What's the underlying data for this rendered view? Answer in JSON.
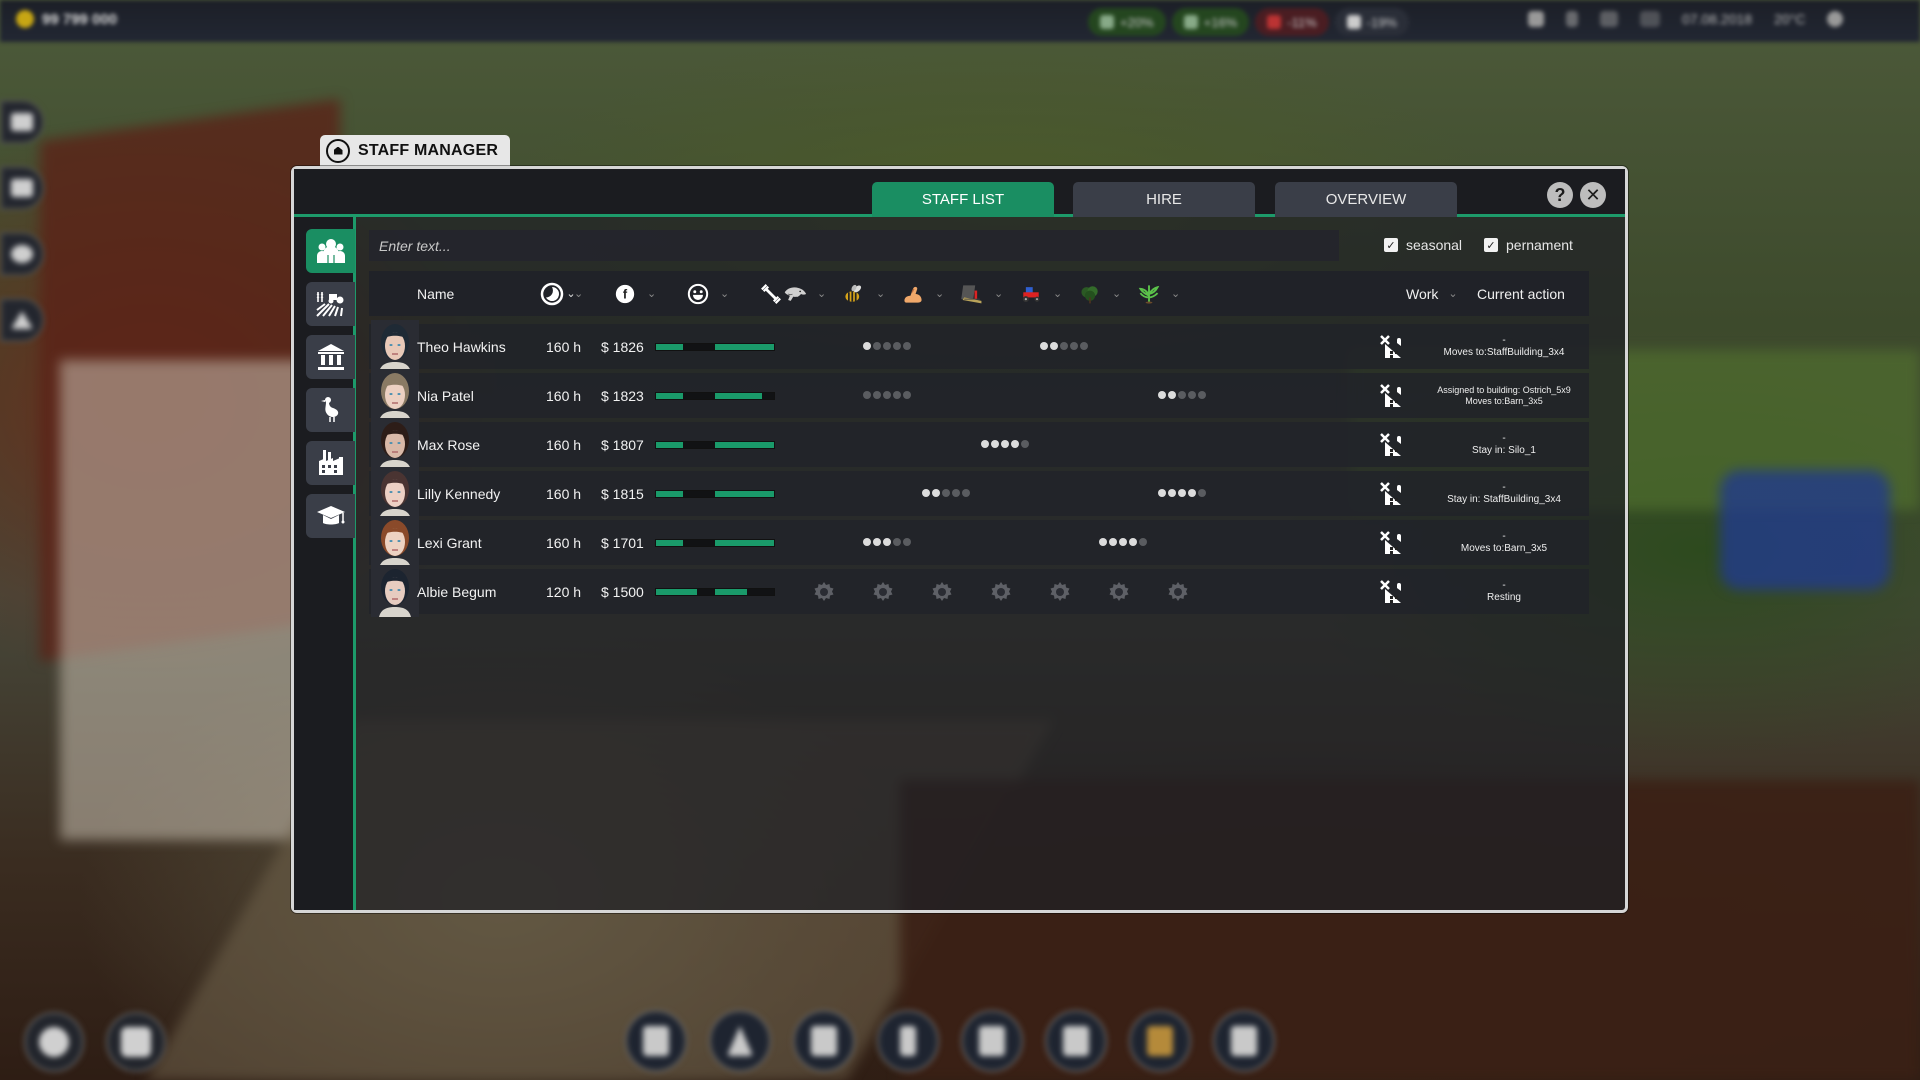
{
  "hud": {
    "money": "99 799 000",
    "stats": [
      {
        "kind": "pos",
        "icon": "trend-up-icon",
        "value": "+20%"
      },
      {
        "kind": "pos",
        "icon": "wheat-icon",
        "value": "+16%"
      },
      {
        "kind": "neg",
        "icon": "trend-down-icon",
        "value": "-11%"
      },
      {
        "kind": "neu",
        "icon": "egg-icon",
        "value": "-19%"
      }
    ],
    "date": "07.08.2018",
    "temperature": "20°C"
  },
  "window": {
    "title": "STAFF MANAGER",
    "tabs": [
      {
        "label": "STAFF LIST",
        "active": true
      },
      {
        "label": "HIRE",
        "active": false
      },
      {
        "label": "OVERVIEW",
        "active": false
      }
    ],
    "help_label": "?",
    "close_label": "✕"
  },
  "sidebar": {
    "items": [
      {
        "name": "staff",
        "icon": "people-icon",
        "active": true
      },
      {
        "name": "fields",
        "icon": "fields-tractor-icon",
        "active": false
      },
      {
        "name": "buildings",
        "icon": "bank-building-icon",
        "active": false
      },
      {
        "name": "animals",
        "icon": "goose-icon",
        "active": false
      },
      {
        "name": "factory",
        "icon": "factory-icon",
        "active": false
      },
      {
        "name": "education",
        "icon": "graduation-cap-icon",
        "active": false
      }
    ]
  },
  "filters": {
    "search_placeholder": "Enter text...",
    "search_value": "",
    "seasonal_label": "seasonal",
    "seasonal_checked": true,
    "permanent_label": "pernament",
    "permanent_checked": true
  },
  "columns": {
    "name": "Name",
    "hours_icon": "clock-icon",
    "salary_icon": "coin-icon",
    "mood_icon": "smiley-icon",
    "strength_icon": "dumbbell-icon",
    "skills": [
      {
        "icon": "cow-icon",
        "skill": "livestock"
      },
      {
        "icon": "bee-icon",
        "skill": "beekeeping"
      },
      {
        "icon": "arm-muscle-icon",
        "skill": "physical"
      },
      {
        "icon": "machine-icon",
        "skill": "processing"
      },
      {
        "icon": "tractor-icon",
        "skill": "driving"
      },
      {
        "icon": "tree-icon",
        "skill": "forestry"
      },
      {
        "icon": "plant-icon",
        "skill": "farming"
      }
    ],
    "work": "Work",
    "current_action": "Current action"
  },
  "staff": [
    {
      "name": "Theo Hawkins",
      "hours": "160 h",
      "salary": "$ 1826",
      "mood": 0.45,
      "strength": 1.0,
      "skills": [
        null,
        1,
        null,
        null,
        2,
        null,
        null
      ],
      "skill_max": 5,
      "action_line1": "-",
      "action_line2": "Moves to:StaffBuilding_3x4",
      "action_small": false,
      "hair": "#1f2a35",
      "skin": "#e8c9b8"
    },
    {
      "name": "Nia Patel",
      "hours": "160 h",
      "salary": "$ 1823",
      "mood": 0.45,
      "strength": 0.8,
      "skills": [
        null,
        0,
        null,
        null,
        null,
        null,
        2
      ],
      "skill_max": 5,
      "action_line1": "Assigned to building: Ostrich_5x9",
      "action_line2": "Moves to:Barn_3x5",
      "action_small": true,
      "hair": "#8a7a64",
      "skin": "#ecd0c2"
    },
    {
      "name": "Max Rose",
      "hours": "160 h",
      "salary": "$ 1807",
      "mood": 0.45,
      "strength": 1.0,
      "skills": [
        null,
        null,
        null,
        4,
        null,
        null,
        null
      ],
      "skill_max": 5,
      "action_line1": "-",
      "action_line2": "Stay in: Silo_1",
      "action_small": false,
      "hair": "#2d1d18",
      "skin": "#d9b9a8"
    },
    {
      "name": "Lilly Kennedy",
      "hours": "160 h",
      "salary": "$ 1815",
      "mood": 0.45,
      "strength": 1.0,
      "skills": [
        null,
        null,
        2,
        null,
        null,
        null,
        4
      ],
      "skill_max": 5,
      "action_line1": "-",
      "action_line2": "Stay in: StaffBuilding_3x4",
      "action_small": false,
      "hair": "#4a3432",
      "skin": "#ecd0c4"
    },
    {
      "name": "Lexi Grant",
      "hours": "160 h",
      "salary": "$ 1701",
      "mood": 0.45,
      "strength": 1.0,
      "skills": [
        null,
        3,
        null,
        null,
        null,
        4,
        null
      ],
      "skill_max": 5,
      "action_line1": "-",
      "action_line2": "Moves to:Barn_3x5",
      "action_small": false,
      "hair": "#8a4a2a",
      "skin": "#edd2c2"
    },
    {
      "name": "Albie Begum",
      "hours": "120 h",
      "salary": "$ 1500",
      "mood": 0.7,
      "strength": 0.55,
      "skills": [
        "pending",
        "pending",
        "pending",
        "pending",
        "pending",
        "pending",
        "pending"
      ],
      "skill_max": 5,
      "action_line1": "-",
      "action_line2": "Resting",
      "action_small": false,
      "hair": "#1c2430",
      "skin": "#e6ccc0"
    }
  ],
  "colors": {
    "accent": "#1a8e62",
    "accent_line": "#1d9a6a",
    "tab_inactive": "#3a3e48",
    "bar_fill": "#1a9a6a"
  }
}
